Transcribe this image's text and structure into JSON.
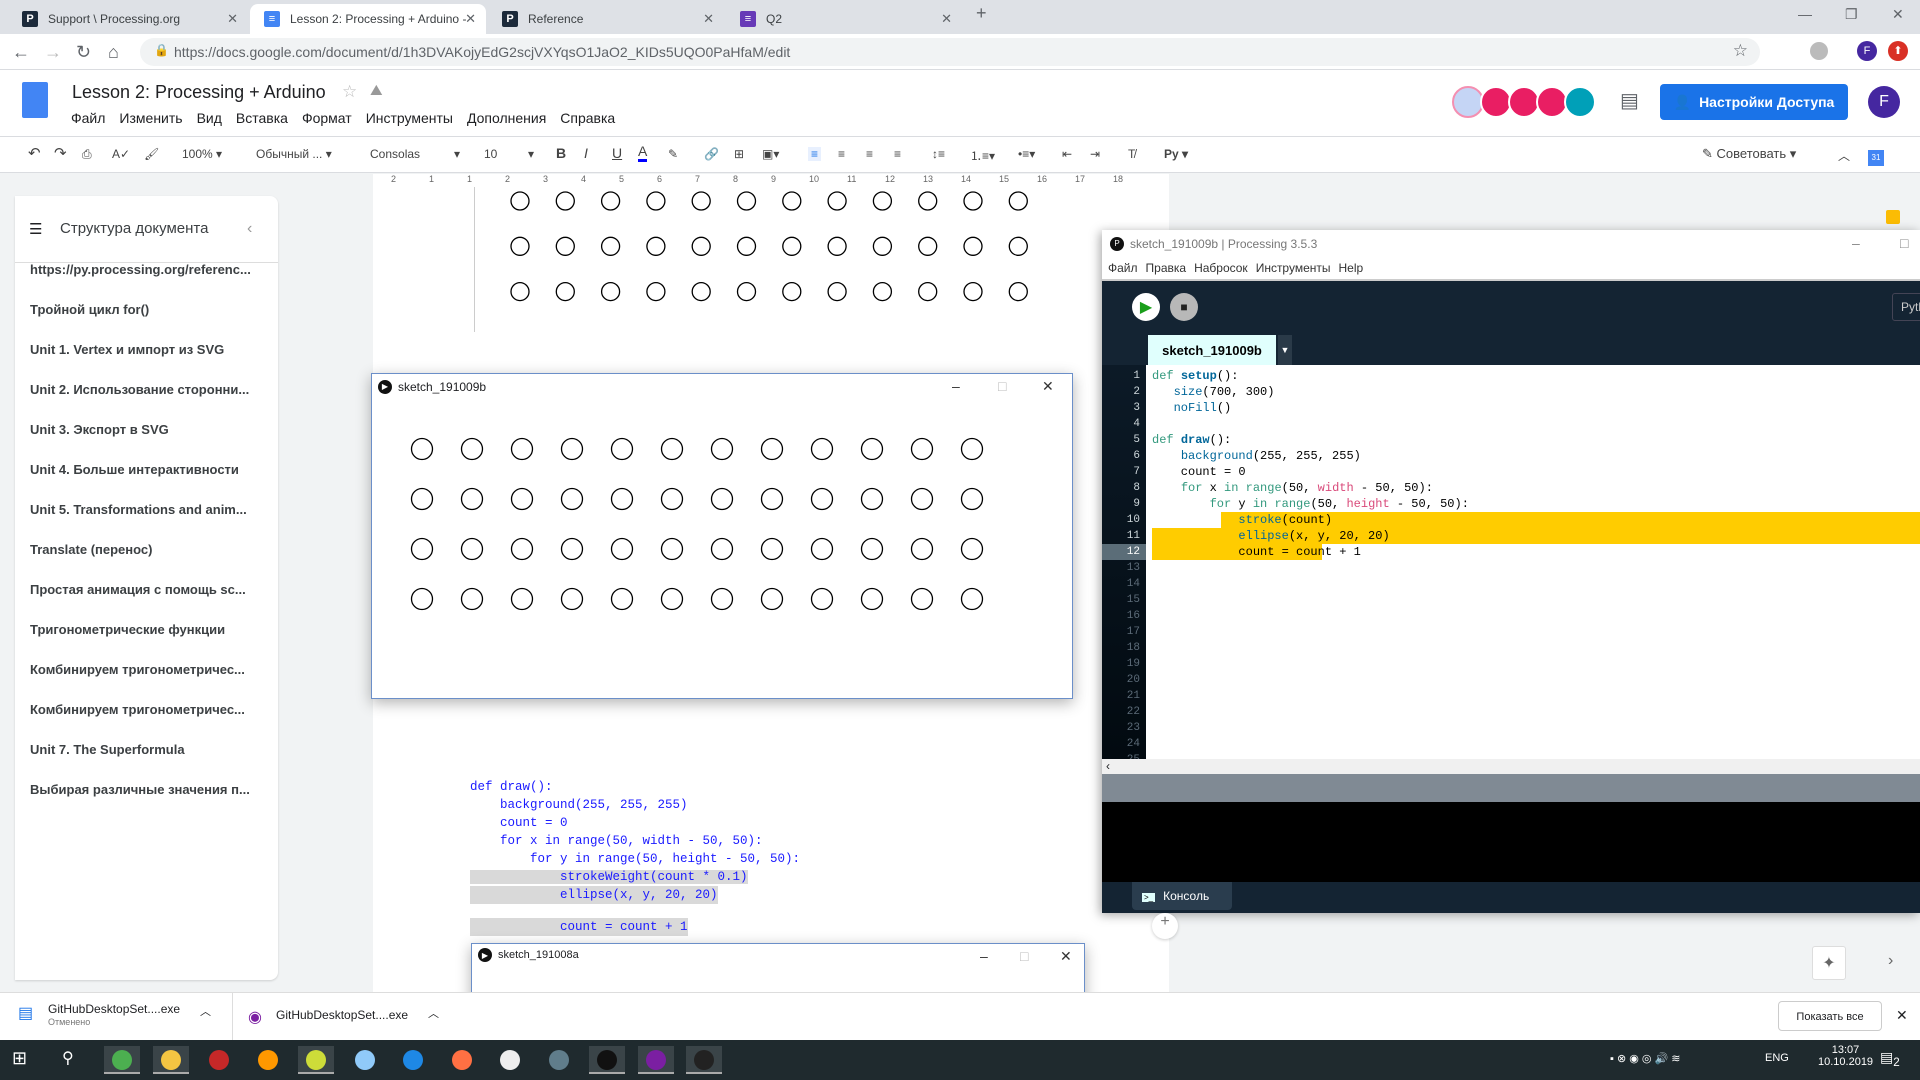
{
  "browser": {
    "tabs": [
      {
        "title": "Support \\ Processing.org",
        "icon": "processing-icon"
      },
      {
        "title": "Lesson 2: Processing + Arduino -",
        "icon": "docs-icon"
      },
      {
        "title": "Reference",
        "icon": "processing-icon"
      },
      {
        "title": "Q2",
        "icon": "forms-icon"
      }
    ],
    "url": "https://docs.google.com/document/d/1h3DVAKojyEdG2scjVXYqsO1JaO2_KIDs5UQO0PaHfaM/edit",
    "profile_initial": "F"
  },
  "docs": {
    "title": "Lesson 2: Processing + Arduino",
    "menu": [
      "Файл",
      "Изменить",
      "Вид",
      "Вставка",
      "Формат",
      "Инструменты",
      "Дополнения",
      "Справка"
    ],
    "share_label": "Настройки Доступа",
    "user_initial": "F",
    "toolbar": {
      "zoom": "100%",
      "style": "Обычный ...",
      "font": "Consolas",
      "size": "10",
      "input_tools": "Ру",
      "suggest": "Советовать"
    },
    "ruler": [
      "2",
      "1",
      "1",
      "2",
      "3",
      "4",
      "5",
      "6",
      "7",
      "8",
      "9",
      "10",
      "11",
      "12",
      "13",
      "14",
      "15",
      "16",
      "17",
      "18"
    ],
    "outline": {
      "title": "Структура документа",
      "items": [
        "https://py.processing.org/referenc...",
        "Тройной цикл for()",
        "Unit 1. Vertex и импорт из SVG",
        "Unit 2. Использование сторонни...",
        "Unit 3. Экспорт в SVG",
        "Unit 4. Больше интерактивности",
        "Unit 5. Transformations and anim...",
        "Translate (перенос)",
        "Простая анимация с помощь sc...",
        "Тригонометрические функции",
        "Комбинируем тригонометричес...",
        "Комбинируем тригонометричес...",
        "Unit 7. The Superformula",
        "Выбирая различные значения п..."
      ]
    },
    "code": [
      "def draw():",
      "    background(255, 255, 255)",
      "    count = 0",
      "    for x in range(50, width - 50, 50):",
      "        for y in range(50, height - 50, 50):",
      "            strokeWeight(count * 0.1)",
      "            ellipse(x, y, 20, 20)",
      "            count = count + 1"
    ]
  },
  "sketch_window": {
    "title": "sketch_191009b"
  },
  "sketch_window_2": {
    "title": "sketch_191008a"
  },
  "processing": {
    "title": "sketch_191009b | Processing 3.5.3",
    "menu": [
      "Файл",
      "Правка",
      "Набросок",
      "Инструменты",
      "Help"
    ],
    "mode": "Pyth",
    "tab": "sketch_191009b",
    "console_label": "Консоль",
    "highlight_color": "#ffcc00",
    "line_count": 25,
    "current_line": 12,
    "code": [
      [
        [
          "def ",
          "k"
        ],
        [
          "setup",
          "fb"
        ],
        [
          "():",
          ""
        ]
      ],
      [
        [
          "   ",
          ""
        ],
        [
          "size",
          "f"
        ],
        [
          "(700, 300)",
          ""
        ]
      ],
      [
        [
          "   ",
          ""
        ],
        [
          "noFill",
          "f"
        ],
        [
          "()",
          ""
        ]
      ],
      [],
      [
        [
          "def ",
          "k"
        ],
        [
          "draw",
          "fb"
        ],
        [
          "():",
          ""
        ]
      ],
      [
        [
          "    ",
          ""
        ],
        [
          "background",
          "f"
        ],
        [
          "(255, 255, 255)",
          ""
        ]
      ],
      [
        [
          "    count = 0",
          ""
        ]
      ],
      [
        [
          "    ",
          ""
        ],
        [
          "for",
          "k"
        ],
        [
          " x ",
          ""
        ],
        [
          "in",
          "k"
        ],
        [
          " ",
          ""
        ],
        [
          "range",
          "k"
        ],
        [
          "(50, ",
          ""
        ],
        [
          "width",
          "s"
        ],
        [
          " - 50, 50):",
          ""
        ]
      ],
      [
        [
          "        ",
          ""
        ],
        [
          "for",
          "k"
        ],
        [
          " y ",
          ""
        ],
        [
          "in",
          "k"
        ],
        [
          " ",
          ""
        ],
        [
          "range",
          "k"
        ],
        [
          "(50, ",
          ""
        ],
        [
          "height",
          "s"
        ],
        [
          " - 50, 50):",
          ""
        ]
      ],
      [
        [
          "            ",
          ""
        ],
        [
          "stroke",
          "f"
        ],
        [
          "(count)",
          ""
        ]
      ],
      [
        [
          "            ",
          ""
        ],
        [
          "ellipse",
          "f"
        ],
        [
          "(x, y, 20, 20)",
          ""
        ]
      ],
      [
        [
          "            count = count + 1",
          ""
        ]
      ]
    ]
  },
  "downloads": {
    "items": [
      {
        "name": "GitHubDesktopSet....exe",
        "status": "Отменено"
      },
      {
        "name": "GitHubDesktopSet....exe",
        "status": ""
      }
    ],
    "show_all": "Показать все"
  },
  "taskbar": {
    "time": "13:07",
    "date": "10.10.2019",
    "lang": "ENG",
    "notifications": "2"
  }
}
